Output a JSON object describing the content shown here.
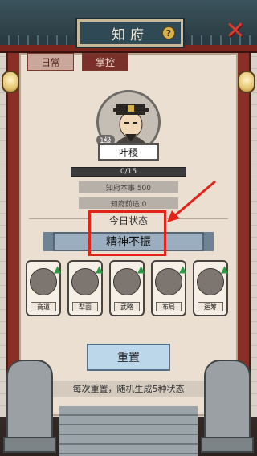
{
  "title": "知府",
  "help_label": "?",
  "close_label": "✕",
  "tabs": [
    {
      "label": "日常",
      "active": true
    },
    {
      "label": "掌控",
      "active": false
    }
  ],
  "official": {
    "level": "1级",
    "name": "叶稷",
    "progress_text": "0/15",
    "progress_fraction": 0.0,
    "ability": "知府本事  500",
    "prospect": "知府前途  0"
  },
  "today_status_label": "今日状态",
  "today_status": "精神不振",
  "cards": [
    {
      "label": "商道",
      "icon": "merchant-icon"
    },
    {
      "label": "犁面",
      "icon": "scroll-icon"
    },
    {
      "label": "武略",
      "icon": "warrior-icon"
    },
    {
      "label": "布局",
      "icon": "layout-icon"
    },
    {
      "label": "运筹",
      "icon": "strategy-icon"
    }
  ],
  "reset_label": "重置",
  "hint": "每次重置，随机生成5种状态",
  "colors": {
    "highlight": "#e2231a",
    "up_arrow": "#2e9b44"
  }
}
